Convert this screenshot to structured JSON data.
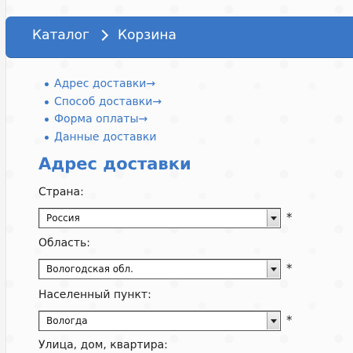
{
  "breadcrumb": {
    "items": [
      "Каталог",
      "Корзина"
    ]
  },
  "steps": [
    "Адрес доставки→",
    "Способ доставки→",
    "Форма оплаты→",
    "Данные доставки"
  ],
  "section_title": "Адрес доставки",
  "fields": {
    "country": {
      "label": "Страна:",
      "value": "Россия",
      "required": "*"
    },
    "region": {
      "label": "Область:",
      "value": "Вологодская обл.",
      "required": "*"
    },
    "locality": {
      "label": "Населенный пункт:",
      "value": "Вологда",
      "required": "*"
    },
    "street": {
      "label": "Улица, дом, квартира:"
    }
  },
  "colors": {
    "accent": "#3a77c6",
    "text": "#222222"
  }
}
